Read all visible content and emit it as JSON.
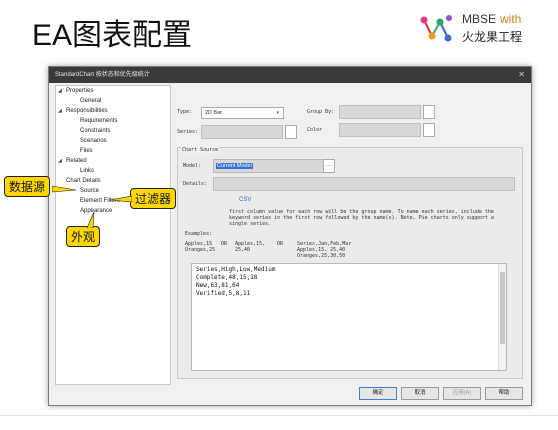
{
  "slide": {
    "title": "EA图表配置"
  },
  "brand": {
    "line1": "MBSE",
    "with": "with",
    "line2": "火龙果工程"
  },
  "window": {
    "title": "StandardChart  按状态和优先级统计",
    "close": "✕"
  },
  "tree": [
    {
      "label": "Properties",
      "expanded": true,
      "level": 0
    },
    {
      "label": "General",
      "level": 2
    },
    {
      "label": "Responsibilities",
      "expanded": true,
      "level": 0
    },
    {
      "label": "Requirements",
      "level": 2
    },
    {
      "label": "Constraints",
      "level": 2
    },
    {
      "label": "Scenarios",
      "level": 2
    },
    {
      "label": "Files",
      "level": 2
    },
    {
      "label": "Related",
      "expanded": true,
      "level": 0
    },
    {
      "label": "Links",
      "level": 2
    },
    {
      "label": "Chart Details",
      "level": 0
    },
    {
      "label": "Source",
      "level": 1
    },
    {
      "label": "Element Filters",
      "level": 1
    },
    {
      "label": "Appearance",
      "level": 1
    }
  ],
  "form": {
    "type_label": "Type:",
    "type_value": "2D Bar",
    "group_by_label": "Group By:",
    "series_label": "Series:",
    "color_label": "Color",
    "chart_source_label": "Chart Source",
    "model_label": "Model:",
    "model_value": "Current Model",
    "details_label": "Details:",
    "tab_csv": "CSV",
    "help_text": "first column value for each row will be the group name. To name each series, include the keyword series in the first row followed by the name(s). Note, Pie charts only support a single series.",
    "examples_label": "Examples:",
    "example_1": "Apples,15\nOranges,25",
    "example_or_1": "OR",
    "example_2": "Apples,15,\n25,40",
    "example_or_2": "OR",
    "example_3": "Series,Jan,Feb,Mar\nApples,15, 25,40\nOranges,25,30,50"
  },
  "editor": {
    "lines": [
      "Series,High,Low,Medium",
      "Complete,48,15,18",
      "New,63,81,64",
      "Verified,5,8,11"
    ]
  },
  "buttons": {
    "ok": "确定",
    "cancel": "取消",
    "apply": "应用(A)",
    "help": "帮助"
  },
  "callouts": {
    "data_source": "数据源",
    "filter": "过滤器",
    "appearance": "外观"
  },
  "colors": {
    "callout": "#ffd700",
    "selection": "#3373d9",
    "titlebar": "#3a3a3a"
  }
}
